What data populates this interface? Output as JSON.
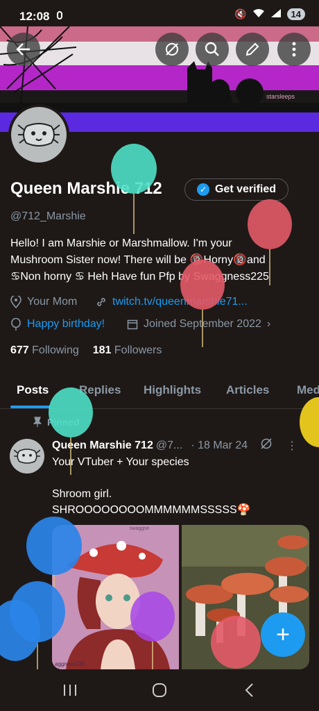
{
  "status_bar": {
    "time": "12:08",
    "battery": "14"
  },
  "banner": {
    "watermark": "starsleeps"
  },
  "profile": {
    "name": "Queen Marshie 712",
    "verify_label": "Get verified",
    "handle": "@712_Marshie",
    "bio_line1": "Hello! I am Marshie or Marshmallow.  I'm your",
    "bio_line2": "Mushroom Sister now! There will be 🔞Horny🔞and",
    "bio_line3": "♋Non horny ♋ Heh Have fun Pfp by Swaggness225",
    "location": "Your Mom",
    "website": "twitch.tv/queenmarshie71...",
    "birthday": "Happy birthday!",
    "joined": "Joined September 2022",
    "following_count": "677",
    "following_label": "Following",
    "followers_count": "181",
    "followers_label": "Followers"
  },
  "tabs": [
    "Posts",
    "Replies",
    "Highlights",
    "Articles",
    "Med"
  ],
  "post": {
    "pinned_label": "Pinned",
    "author": "Queen Marshie 712",
    "handle_short": "@7...",
    "date": "· 18 Mar 24",
    "line1": "Your VTuber + Your species",
    "line2": "Shroom girl.",
    "line3": "SHROOOOOOOOMMMMMMSSSSS🍄",
    "img1_credit": "aggness225",
    "img1_tag": "swaggne"
  },
  "icons": {
    "back": "arrow-left-icon",
    "incognito": "eye-slash-icon",
    "search": "search-icon",
    "edit": "pencil-icon",
    "more": "more-vertical-icon"
  }
}
